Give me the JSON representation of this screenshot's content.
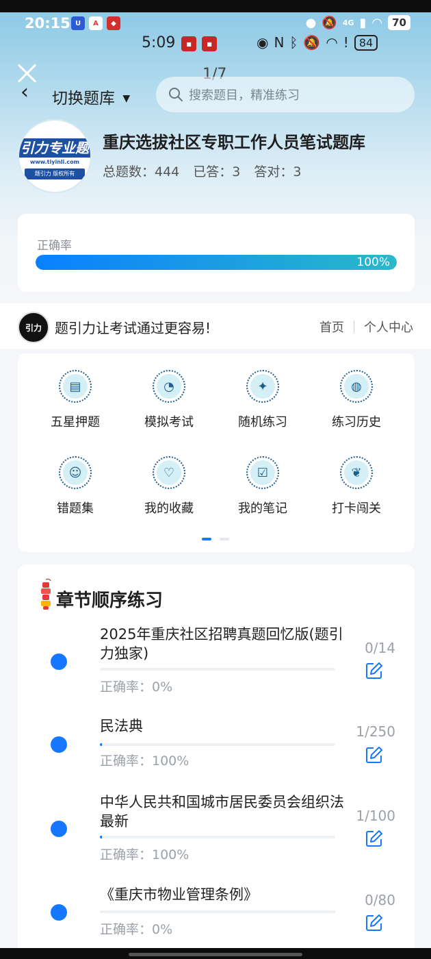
{
  "status_bar": {
    "time": "20:15",
    "network": "4G",
    "battery": "70"
  },
  "inner_status_bar": {
    "time": "5:09",
    "battery": "84"
  },
  "overlay": {
    "pager": "1/7"
  },
  "header": {
    "switch_label": "切换题库",
    "search_placeholder": "搜索题目，精准练习"
  },
  "bank": {
    "logo_text": "引力专业题",
    "logo_url": "www.tiyinli.com",
    "logo_copyright": "题引力 版权所有",
    "title": "重庆选拔社区专职工作人员笔试题库",
    "total_label": "总题数：444",
    "answered_label": "已答：3",
    "correct_label": "答对：3"
  },
  "accuracy": {
    "label": "正确率",
    "value": 1.0,
    "value_text": "100%"
  },
  "promo": {
    "logo_text": "引力",
    "slogan": "题引力让考试通过更容易!",
    "nav_home": "首页",
    "nav_personal": "个人中心"
  },
  "features": [
    {
      "label": "五星押题",
      "icon": "id-card-icon"
    },
    {
      "label": "模拟考试",
      "icon": "gauge-icon"
    },
    {
      "label": "随机练习",
      "icon": "compass-icon"
    },
    {
      "label": "练习历史",
      "icon": "globe-icon"
    },
    {
      "label": "错题集",
      "icon": "head-icon"
    },
    {
      "label": "我的收藏",
      "icon": "heart-icon"
    },
    {
      "label": "我的笔记",
      "icon": "note-check-icon"
    },
    {
      "label": "打卡闯关",
      "icon": "leaf-icon"
    }
  ],
  "chapters": {
    "title": "章节顺序练习",
    "items": [
      {
        "name": "2025年重庆社区招聘真题回忆版(题引力独家)",
        "progress": "0/14",
        "accuracy": "正确率：0%",
        "fraction": 0.0
      },
      {
        "name": "民法典",
        "progress": "1/250",
        "accuracy": "正确率：100%",
        "fraction": 0.004
      },
      {
        "name": "中华人民共和国城市居民委员会组织法 最新",
        "progress": "1/100",
        "accuracy": "正确率：100%",
        "fraction": 0.01
      },
      {
        "name": "《重庆市物业管理条例》",
        "progress": "0/80",
        "accuracy": "正确率：0%",
        "fraction": 0.0
      }
    ]
  },
  "colors": {
    "accent": "#1677ff",
    "progress_end": "#2bb8c8",
    "logo_blue": "#1d4fa3"
  }
}
